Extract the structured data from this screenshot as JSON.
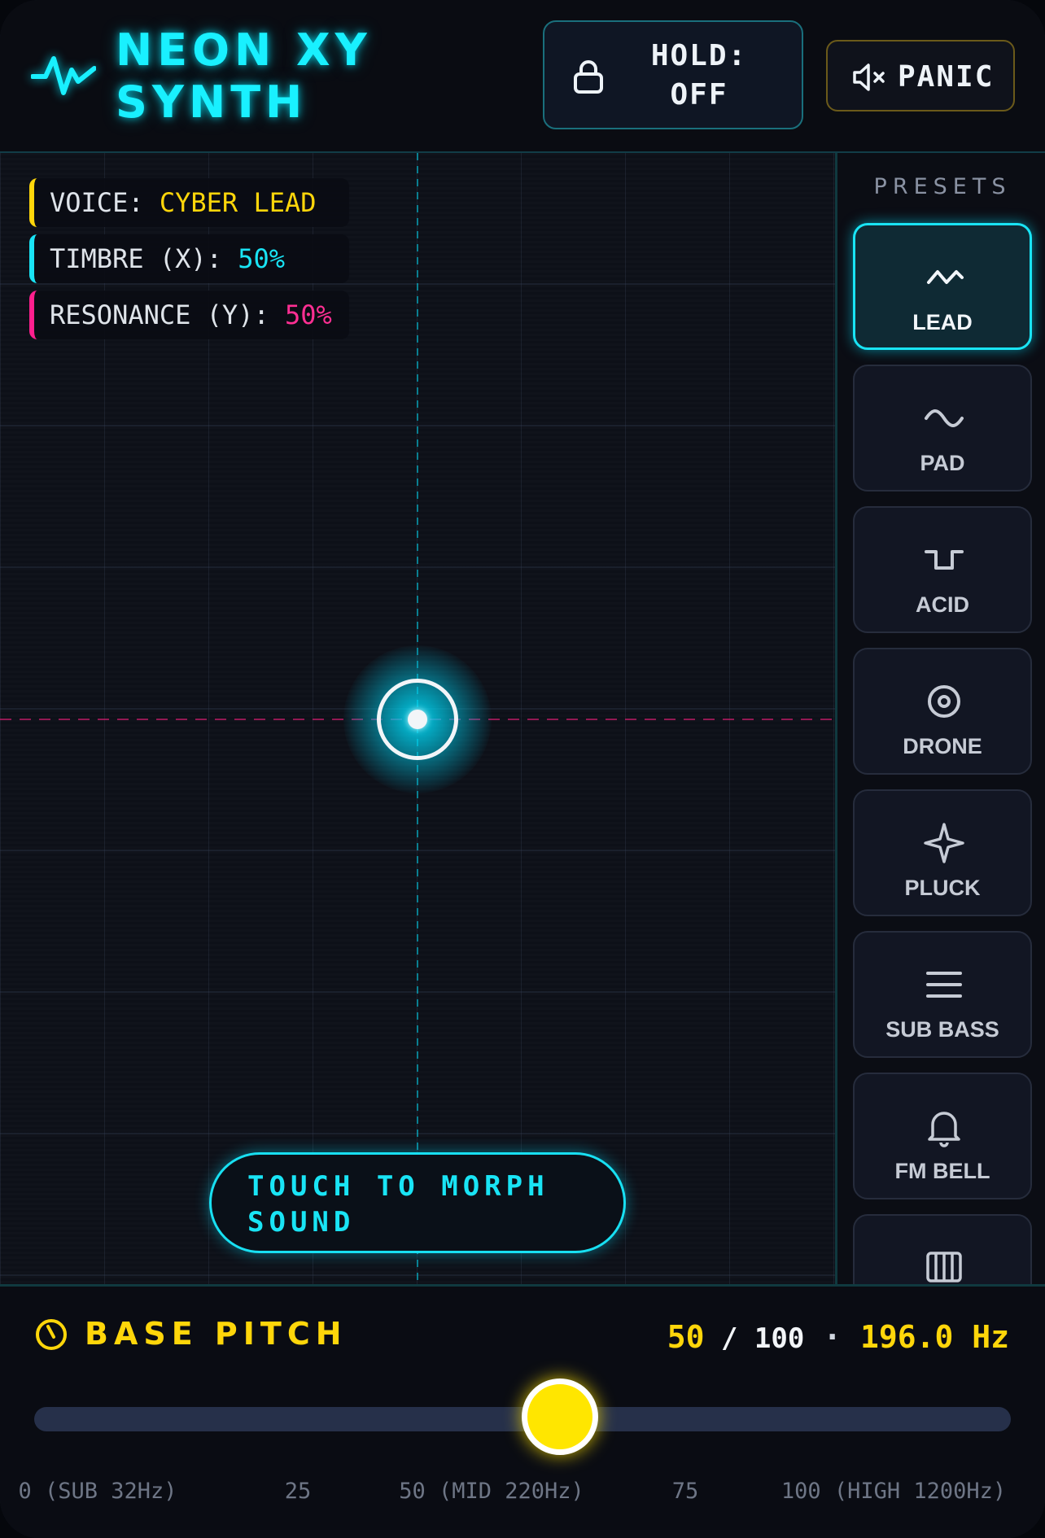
{
  "app": {
    "title_line1": "NEON XY",
    "title_line2": "SYNTH"
  },
  "header": {
    "hold_label_line1": "HOLD:",
    "hold_label_line2": "OFF",
    "hold_icon": "lock-icon",
    "panic_label": "PANIC",
    "panic_icon": "mute-icon",
    "logo_icon": "waveform-icon"
  },
  "readouts": {
    "voice_label": "VOICE:",
    "voice_value": "CYBER LEAD",
    "timbre_label": "TIMBRE (X):",
    "timbre_value": "50%",
    "resonance_label": "RESONANCE (Y):",
    "resonance_value": "50%"
  },
  "pad": {
    "x_percent": 50,
    "y_percent": 50,
    "hint_line1": "TOUCH TO MORPH",
    "hint_line2": "SOUND"
  },
  "presets": {
    "title": "PRESETS",
    "items": [
      {
        "label": "LEAD",
        "icon": "zigzag-wave-icon",
        "active": true
      },
      {
        "label": "PAD",
        "icon": "sine-wave-icon",
        "active": false
      },
      {
        "label": "ACID",
        "icon": "square-wave-icon",
        "active": false
      },
      {
        "label": "DRONE",
        "icon": "target-icon",
        "active": false
      },
      {
        "label": "PLUCK",
        "icon": "sparkle-icon",
        "active": false
      },
      {
        "label": "SUB BASS",
        "icon": "menu-lines-icon",
        "active": false
      },
      {
        "label": "FM BELL",
        "icon": "bell-icon",
        "active": false
      },
      {
        "label": "",
        "icon": "piano-keys-icon",
        "active": false
      }
    ]
  },
  "pitch": {
    "title": "BASE PITCH",
    "icon": "clock-icon",
    "value": "50",
    "separator": " / ",
    "max": "100",
    "dot": " · ",
    "frequency": "196.0 Hz",
    "slider_value": 50,
    "slider_max": 100,
    "ticks": [
      {
        "label": "0 (SUB 32Hz)",
        "value": 0
      },
      {
        "label": "25",
        "value": 25
      },
      {
        "label": "50 (MID 220Hz)",
        "value": 50
      },
      {
        "label": "75",
        "value": 75
      },
      {
        "label": "100 (HIGH 1200Hz)",
        "value": 100
      }
    ]
  },
  "colors": {
    "cyan": "#19e4f5",
    "yellow": "#ffd60a",
    "pink": "#ff1f8e"
  }
}
